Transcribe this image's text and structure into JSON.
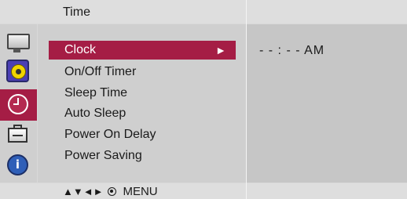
{
  "header": {
    "title": "Time"
  },
  "sidebar": {
    "icons": [
      {
        "name": "picture-icon"
      },
      {
        "name": "audio-icon"
      },
      {
        "name": "time-icon",
        "selected": true
      },
      {
        "name": "option-icon"
      },
      {
        "name": "information-icon",
        "glyph": "i"
      }
    ]
  },
  "menu": {
    "items": [
      {
        "label": "Clock",
        "selected": true
      },
      {
        "label": "On/Off Timer"
      },
      {
        "label": "Sleep Time"
      },
      {
        "label": "Auto Sleep"
      },
      {
        "label": "Power On Delay"
      },
      {
        "label": "Power Saving"
      }
    ],
    "selected_arrow": "►"
  },
  "value": {
    "clock_text": "- - : - -  AM"
  },
  "footer": {
    "nav_arrows": "▲▼◄►",
    "menu_label": "MENU"
  },
  "colors": {
    "highlight": "#a51d45",
    "panel": "#cfcfcf",
    "value_panel": "#c6c6c6"
  }
}
